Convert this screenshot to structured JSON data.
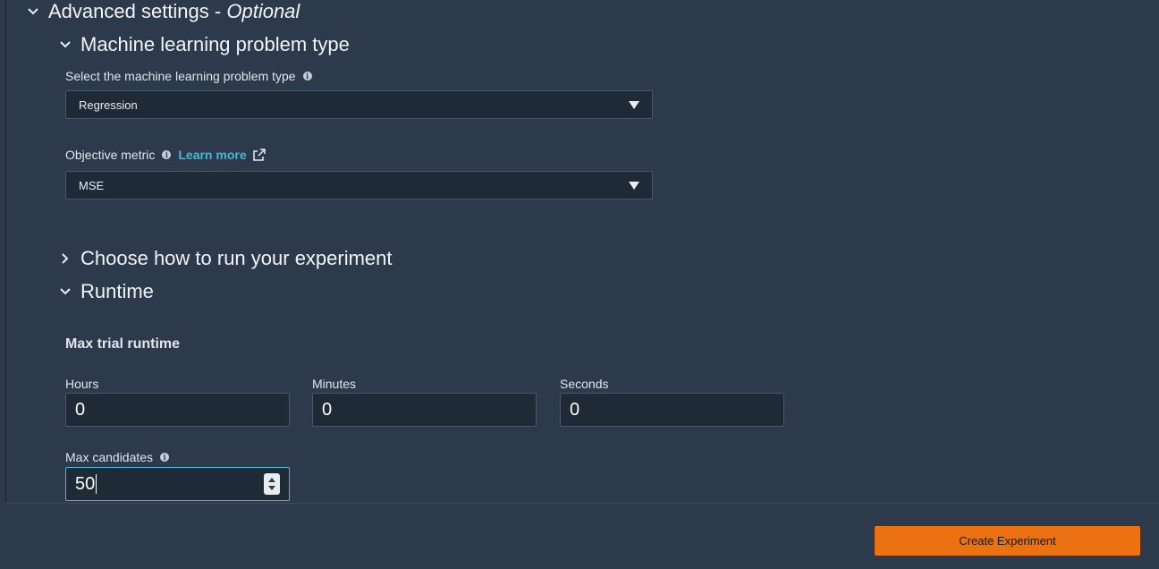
{
  "advanced_settings": {
    "title": "Advanced settings -",
    "optional": "Optional"
  },
  "ml_problem_type": {
    "title": "Machine learning problem type",
    "select_label": "Select the machine learning problem type",
    "selected_value": "Regression",
    "info_icon": "info-icon"
  },
  "objective_metric": {
    "label": "Objective metric",
    "learn_more": "Learn more",
    "selected_value": "MSE",
    "external_link_icon": "external-link-icon"
  },
  "run_experiment": {
    "title": "Choose how to run your experiment",
    "expanded": false
  },
  "runtime": {
    "title": "Runtime",
    "expanded": true,
    "max_trial_runtime_label": "Max trial runtime",
    "hours_label": "Hours",
    "hours_value": "0",
    "minutes_label": "Minutes",
    "minutes_value": "0",
    "seconds_label": "Seconds",
    "seconds_value": "0",
    "max_candidates_label": "Max candidates",
    "max_candidates_value": "50"
  },
  "footer": {
    "create_button": "Create Experiment"
  },
  "colors": {
    "background": "#2d3a4b",
    "input_bg": "#1f2a37",
    "link": "#44b9d6",
    "primary": "#ec7211",
    "focus": "#44b9d6"
  }
}
